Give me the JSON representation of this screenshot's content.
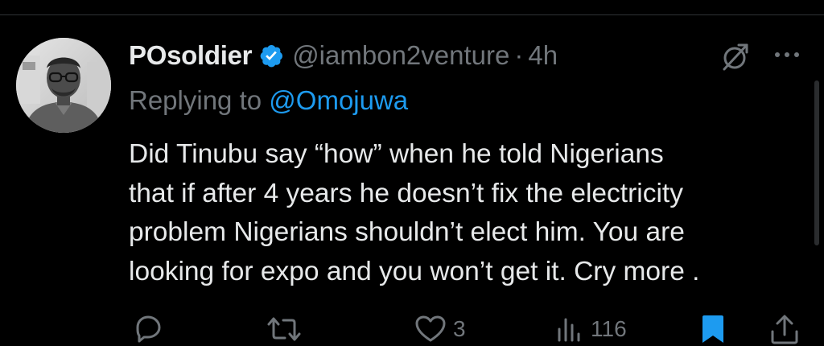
{
  "tweet": {
    "author_name": "POsoldier",
    "handle": "@iambon2venture",
    "separator": "·",
    "time": "4h",
    "replying_prefix": "Replying to",
    "replying_to": "@Omojuwa",
    "text_lines": [
      "Did Tinubu say “how” when he told Nigerians",
      "that if after 4 years he doesn’t fix the electricity",
      "problem Nigerians shouldn’t elect him. You are",
      "looking for expo and you won’t get it. Cry more ."
    ]
  },
  "actions": {
    "reply_icon": "reply-icon",
    "retweet_icon": "retweet-icon",
    "like_icon": "heart-icon",
    "like_count": "3",
    "views_icon": "views-icon",
    "views_count": "116",
    "bookmark_icon": "bookmark-icon",
    "share_icon": "share-icon"
  },
  "icons": {
    "verified": "verified-badge-icon",
    "grok": "grok-icon",
    "more": "more-icon"
  },
  "colors": {
    "background": "#000000",
    "text_primary": "#e7e9ea",
    "text_secondary": "#71767b",
    "accent": "#1d9bf0"
  }
}
